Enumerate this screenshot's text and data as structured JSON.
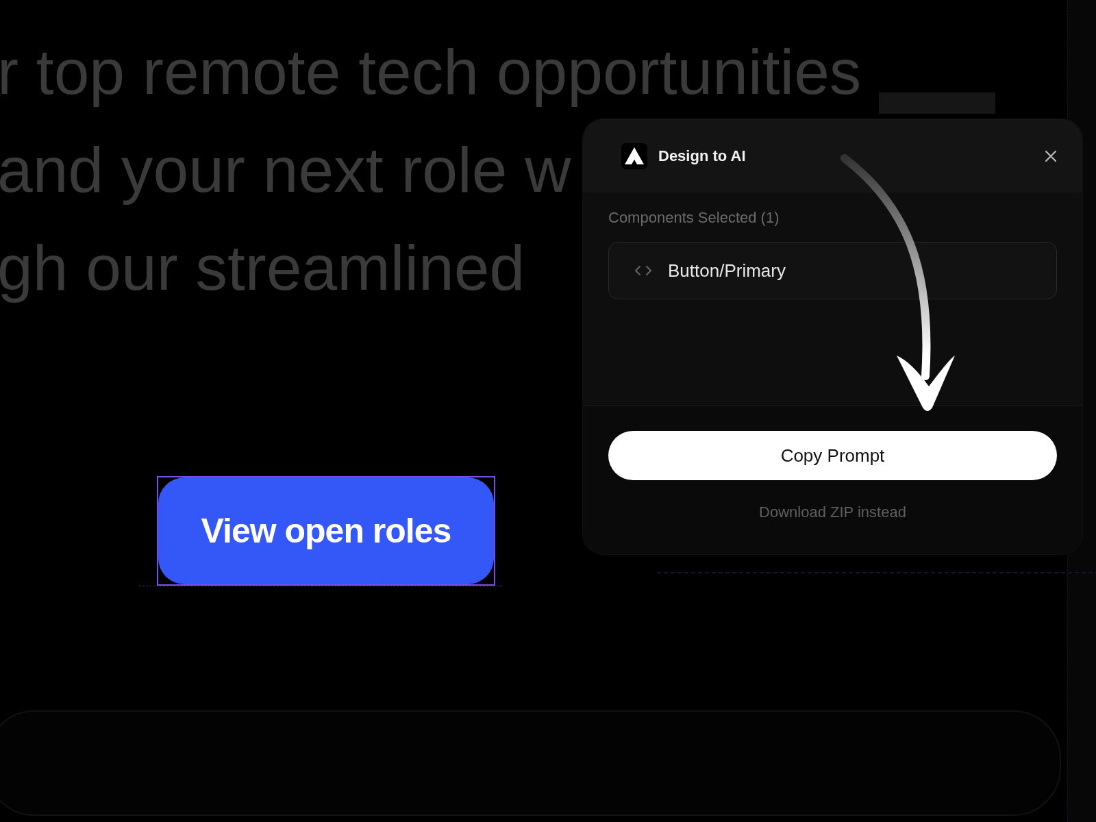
{
  "background_text": {
    "lines": [
      "r top remote tech opportunities",
      "and your next role w",
      "gh our streamlined"
    ]
  },
  "canvas_button": {
    "label": "View open roles",
    "selected": true
  },
  "panel": {
    "title": "Design to AI",
    "section_label": "Components Selected (1)",
    "components": [
      {
        "name": "Button/Primary"
      }
    ],
    "primary_button": "Copy Prompt",
    "secondary_link": "Download ZIP instead"
  }
}
